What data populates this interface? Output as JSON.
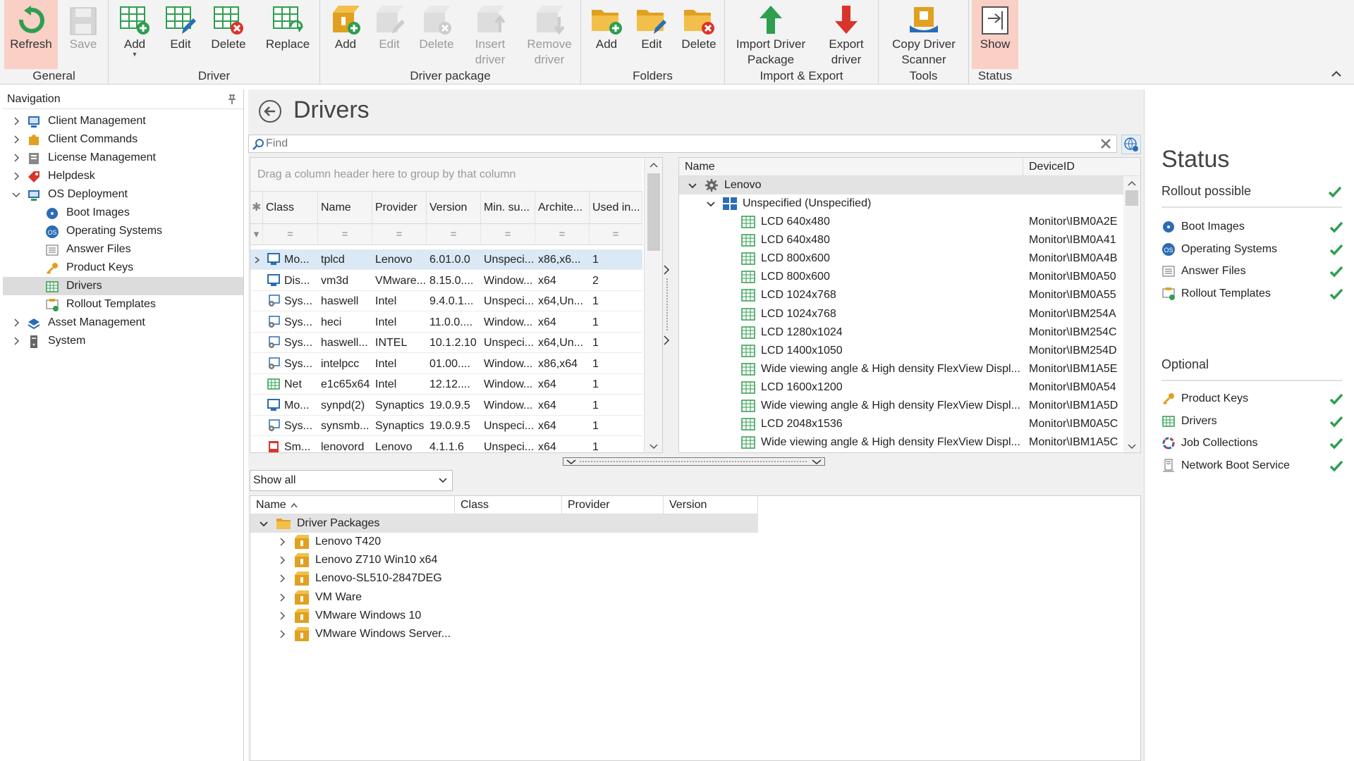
{
  "ribbon": {
    "groups": [
      {
        "caption": "General",
        "buttons": [
          "Refresh",
          "Save"
        ]
      },
      {
        "caption": "Driver",
        "buttons": [
          "Add",
          "Edit",
          "Delete",
          "Replace"
        ]
      },
      {
        "caption": "Driver package",
        "buttons": [
          "Add",
          "Edit",
          "Delete",
          "Insert driver",
          "Remove driver"
        ]
      },
      {
        "caption": "Folders",
        "buttons": [
          "Add",
          "Edit",
          "Delete"
        ]
      },
      {
        "caption": "Import & Export",
        "buttons": [
          "Import Driver Package",
          "Export driver"
        ]
      },
      {
        "caption": "Tools",
        "buttons": [
          "Copy Driver Scanner"
        ]
      },
      {
        "caption": "Status",
        "buttons": [
          "Show"
        ]
      }
    ]
  },
  "nav": {
    "title": "Navigation",
    "items": [
      {
        "label": "Client Management"
      },
      {
        "label": "Client Commands"
      },
      {
        "label": "License Management"
      },
      {
        "label": "Helpdesk"
      },
      {
        "label": "OS Deployment"
      },
      {
        "label": "Boot Images"
      },
      {
        "label": "Operating Systems"
      },
      {
        "label": "Answer Files"
      },
      {
        "label": "Product Keys"
      },
      {
        "label": "Drivers"
      },
      {
        "label": "Rollout Templates"
      },
      {
        "label": "Asset Management"
      },
      {
        "label": "System"
      }
    ]
  },
  "page": {
    "title": "Drivers"
  },
  "find": {
    "placeholder": "Find"
  },
  "grid": {
    "group_hint": "Drag a column header here to group by that column",
    "columns": [
      "Class",
      "Name",
      "Provider",
      "Version",
      "Min. su...",
      "Archite...",
      "Used in..."
    ],
    "filter_symbol": "=",
    "rows": [
      [
        "Mo...",
        "tplcd",
        "Lenovo",
        "6.01.0.0",
        "Unspeci...",
        "x86,x6...",
        "1"
      ],
      [
        "Dis...",
        "vm3d",
        "VMware...",
        "8.15.0....",
        "Window...",
        "x64",
        "2"
      ],
      [
        "Sys...",
        "haswell",
        "Intel",
        "9.4.0.1...",
        "Unspeci...",
        "x64,Un...",
        "1"
      ],
      [
        "Sys...",
        "heci",
        "Intel",
        "11.0.0....",
        "Window...",
        "x64",
        "1"
      ],
      [
        "Sys...",
        "haswell...",
        "INTEL",
        "10.1.2.10",
        "Unspeci...",
        "x64,Un...",
        "1"
      ],
      [
        "Sys...",
        "intelpcc",
        "Intel",
        "01.00....",
        "Window...",
        "x86,x64",
        "1"
      ],
      [
        "Net",
        "e1c65x64",
        "Intel",
        "12.12....",
        "Window...",
        "x64",
        "1"
      ],
      [
        "Mo...",
        "synpd(2)",
        "Synaptics",
        "19.0.9.5",
        "Window...",
        "x64",
        "1"
      ],
      [
        "Sys...",
        "synsmb...",
        "Synaptics",
        "19.0.9.5",
        "Unspeci...",
        "x64",
        "1"
      ],
      [
        "Sm...",
        "lenovord",
        "Lenovo",
        "4.1.1.6",
        "Unspeci...",
        "x64",
        "1"
      ]
    ]
  },
  "tree": {
    "columns": [
      "Name",
      "DeviceID"
    ],
    "root": "Lenovo",
    "group": "Unspecified (Unspecified)",
    "rows": [
      [
        "LCD 640x480",
        "Monitor\\IBM0A2E"
      ],
      [
        "LCD 640x480",
        "Monitor\\IBM0A41"
      ],
      [
        "LCD 800x600",
        "Monitor\\IBM0A4B"
      ],
      [
        "LCD 800x600",
        "Monitor\\IBM0A50"
      ],
      [
        "LCD 1024x768",
        "Monitor\\IBM0A55"
      ],
      [
        "LCD 1024x768",
        "Monitor\\IBM254A"
      ],
      [
        "LCD 1280x1024",
        "Monitor\\IBM254C"
      ],
      [
        "LCD 1400x1050",
        "Monitor\\IBM254D"
      ],
      [
        "Wide viewing angle & High density FlexView Displ...",
        "Monitor\\IBM1A5E"
      ],
      [
        "LCD 1600x1200",
        "Monitor\\IBM0A54"
      ],
      [
        "Wide viewing angle & High density FlexView Displ...",
        "Monitor\\IBM1A5D"
      ],
      [
        "LCD 2048x1536",
        "Monitor\\IBM0A5C"
      ],
      [
        "Wide viewing angle & High density FlexView Displ...",
        "Monitor\\IBM1A5C"
      ]
    ]
  },
  "packages": {
    "filter": "Show all",
    "columns": [
      "Name",
      "Class",
      "Provider",
      "Version"
    ],
    "root": "Driver Packages",
    "items": [
      "Lenovo T420",
      "Lenovo Z710 Win10 x64",
      "Lenovo-SL510-2847DEG",
      "VM Ware",
      "VMware Windows 10",
      "VMware Windows Server..."
    ]
  },
  "status": {
    "title": "Status",
    "rollout": "Rollout possible",
    "required": [
      "Boot Images",
      "Operating Systems",
      "Answer Files",
      "Rollout Templates"
    ],
    "optional_title": "Optional",
    "optional": [
      "Product Keys",
      "Drivers",
      "Job Collections",
      "Network Boot Service"
    ]
  },
  "colors": {
    "accent_green": "#2e9e4f",
    "accent_blue": "#2b6cb5",
    "delete_red": "#d9342b",
    "folder_gold": "#e0a020",
    "selection": "#dbe9f6"
  }
}
